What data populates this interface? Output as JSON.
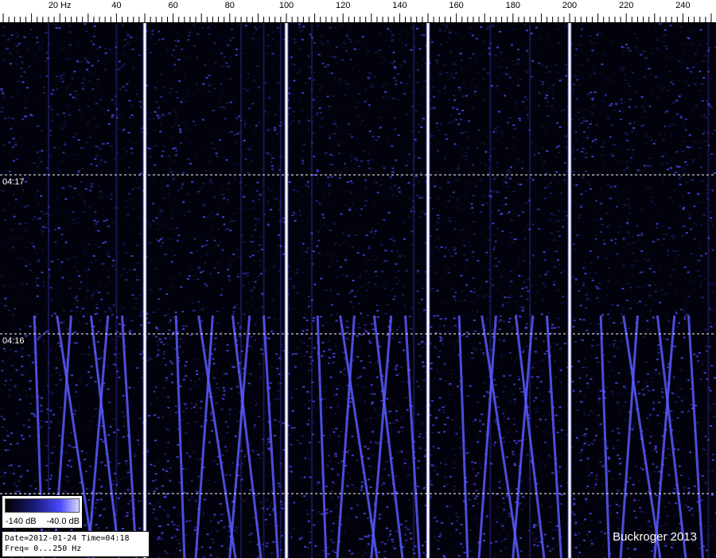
{
  "chart_data": {
    "type": "heatmap",
    "title": "",
    "xlabel": "Hz",
    "ylabel": "",
    "xlim": [
      0,
      250
    ],
    "x_ticks": [
      {
        "value": 20,
        "label": "20 Hz"
      },
      {
        "value": 40,
        "label": "40"
      },
      {
        "value": 60,
        "label": "60"
      },
      {
        "value": 80,
        "label": "80"
      },
      {
        "value": 100,
        "label": "100"
      },
      {
        "value": 120,
        "label": "120"
      },
      {
        "value": 140,
        "label": "140"
      },
      {
        "value": 160,
        "label": "160"
      },
      {
        "value": 180,
        "label": "180"
      },
      {
        "value": 200,
        "label": "200"
      },
      {
        "value": 220,
        "label": "220"
      },
      {
        "value": 240,
        "label": "240"
      }
    ],
    "time_markers": [
      {
        "label": "04:17"
      },
      {
        "label": "04:16"
      },
      {
        "label": ""
      }
    ],
    "strong_lines_hz": [
      50,
      100,
      150,
      200
    ],
    "colorbar": {
      "min_label": "-140 dB",
      "max_label": "-40.0 dB"
    },
    "grid": true
  },
  "info": {
    "line1": "Date=2012-01-24 Time=04:18",
    "line2": "Freq= 0...250 Hz"
  },
  "watermark": "Buckroger 2013",
  "colors": {
    "signal": "#5a5aff",
    "hum_line": "#ffffff",
    "background": "#02020c"
  }
}
